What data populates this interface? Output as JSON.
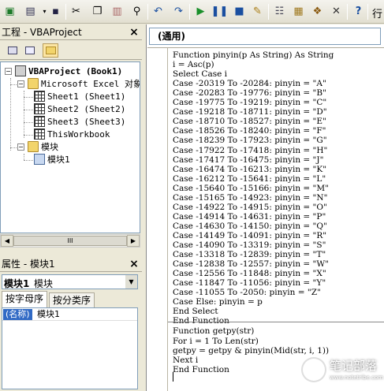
{
  "toolbar": {
    "trailing_label": "行"
  },
  "project_pane": {
    "title": "工程 - VBAProject",
    "close_label": "×",
    "tree": [
      {
        "label": "VBAProject (Book1)",
        "kind": "project",
        "expanded": true
      },
      {
        "label": "Microsoft Excel 对象",
        "kind": "folder",
        "expanded": true
      },
      {
        "label": "Sheet1 (Sheet1)",
        "kind": "sheet"
      },
      {
        "label": "Sheet2 (Sheet2)",
        "kind": "sheet"
      },
      {
        "label": "Sheet3 (Sheet3)",
        "kind": "sheet"
      },
      {
        "label": "ThisWorkbook",
        "kind": "workbook"
      },
      {
        "label": "模块",
        "kind": "folder",
        "expanded": true
      },
      {
        "label": "模块1",
        "kind": "module"
      }
    ],
    "scroll_thumb_label": "III"
  },
  "properties_pane": {
    "title": "属性 - 模块1",
    "close_label": "×",
    "combo_object_name": "模块1",
    "combo_object_type": "模块",
    "tabs": [
      "按字母序",
      "按分类序"
    ],
    "rows": [
      {
        "name": "(名称)",
        "value": "模块1"
      }
    ]
  },
  "code_window": {
    "object_combo": "(通用)",
    "lines": [
      "Function pinyin(p As String) As String",
      "i = Asc(p)",
      "Select Case i",
      "Case -20319 To -20284: pinyin = \"A\"",
      "Case -20283 To -19776: pinyin = \"B\"",
      "Case -19775 To -19219: pinyin = \"C\"",
      "Case -19218 To -18711: pinyin = \"D\"",
      "Case -18710 To -18527: pinyin = \"E\"",
      "Case -18526 To -18240: pinyin = \"F\"",
      "Case -18239 To -17923: pinyin = \"G\"",
      "Case -17922 To -17418: pinyin = \"H\"",
      "Case -17417 To -16475: pinyin = \"J\"",
      "Case -16474 To -16213: pinyin = \"K\"",
      "Case -16212 To -15641: pinyin = \"L\"",
      "Case -15640 To -15166: pinyin = \"M\"",
      "Case -15165 To -14923: pinyin = \"N\"",
      "Case -14922 To -14915: pinyin = \"O\"",
      "Case -14914 To -14631: pinyin = \"P\"",
      "Case -14630 To -14150: pinyin = \"Q\"",
      "Case -14149 To -14091: pinyin = \"R\"",
      "Case -14090 To -13319: pinyin = \"S\"",
      "Case -13318 To -12839: pinyin = \"T\"",
      "Case -12838 To -12557: pinyin = \"W\"",
      "Case -12556 To -11848: pinyin = \"X\"",
      "Case -11847 To -11056: pinyin = \"Y\"",
      "Case -11055 To -2050: pinyin = \"Z\"",
      "Case Else: pinyin = p",
      "End Select",
      "End Function",
      "Function getpy(str)",
      "For i = 1 To Len(str)",
      "getpy = getpy & pinyin(Mid(str, i, 1))",
      "Next i",
      "End Function"
    ]
  },
  "watermark": {
    "title": "笔记部落",
    "url": "www.notetribe.com"
  }
}
